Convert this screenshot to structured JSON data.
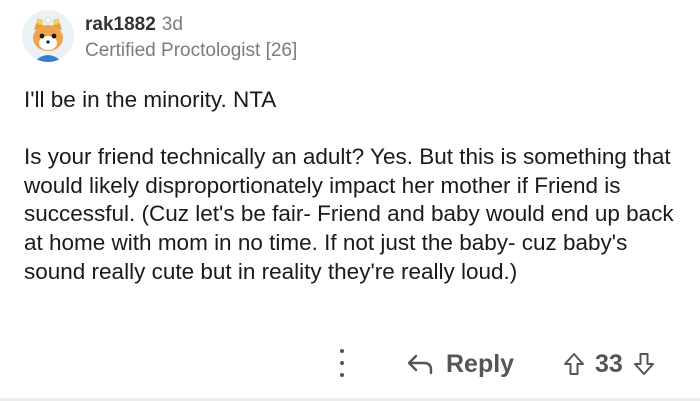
{
  "comment": {
    "username": "rak1882",
    "age": "3d",
    "flair": "Certified Proctologist [26]",
    "paragraphs": [
      "I'll be in the minority. NTA",
      "Is your friend technically an adult? Yes. But this is something that would likely disproportionately impact her mother if Friend is successful. (Cuz let's be fair- Friend and baby would end up back at home with mom in no time. If not just the baby- cuz baby's sound really cute but in reality they're really loud.)"
    ]
  },
  "actions": {
    "reply_label": "Reply",
    "vote_count": "33",
    "icons": {
      "more": "more-vertical-icon",
      "reply": "reply-arrow-icon",
      "upvote": "upvote-arrow-icon",
      "downvote": "downvote-arrow-icon"
    }
  },
  "colors": {
    "text": "#1a1a1b",
    "muted": "#7c7c7c",
    "action": "#555555"
  }
}
